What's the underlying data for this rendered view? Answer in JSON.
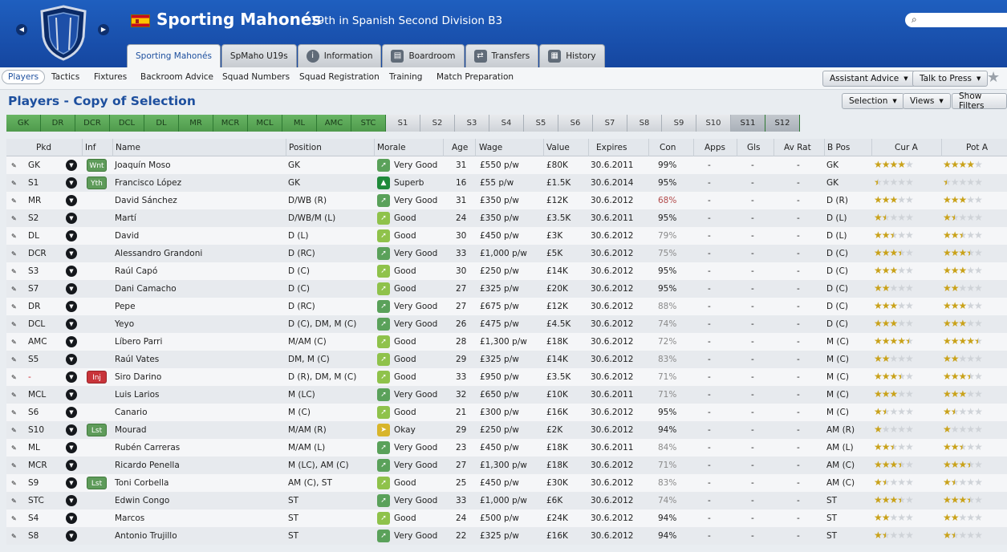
{
  "header": {
    "club_name": "Sporting Mahonés",
    "subtitle": "19th in Spanish Second Division B3",
    "nav_prev": "◀",
    "nav_next": "▶",
    "search_placeholder": ""
  },
  "tabs": [
    {
      "label": "Sporting Mahonés",
      "icon": ""
    },
    {
      "label": "SpMaho U19s",
      "icon": ""
    },
    {
      "label": "Information",
      "icon": "info-icon"
    },
    {
      "label": "Boardroom",
      "icon": "boardroom-icon"
    },
    {
      "label": "Transfers",
      "icon": "transfers-icon"
    },
    {
      "label": "History",
      "icon": "history-icon"
    }
  ],
  "subnav": {
    "items": [
      "Players",
      "Tactics",
      "Fixtures",
      "Backroom Advice",
      "Squad Numbers",
      "Squad Registration",
      "Training",
      "Match Preparation"
    ],
    "assistant_advice": "Assistant Advice",
    "talk_to_press": "Talk to Press",
    "selection": "Selection",
    "views": "Views",
    "show_filters": "Show Filters"
  },
  "page_title": "Players - Copy of Selection",
  "selection_positions": [
    "GK",
    "DR",
    "DCR",
    "DCL",
    "DL",
    "MR",
    "MCR",
    "MCL",
    "ML",
    "AMC",
    "STC",
    "S1",
    "S2",
    "S3",
    "S4",
    "S5",
    "S6",
    "S7",
    "S8",
    "S9",
    "S10",
    "S11",
    "S12"
  ],
  "columns": {
    "pkd": "Pkd",
    "inf": "Inf",
    "name": "Name",
    "position": "Position",
    "morale": "Morale",
    "age": "Age",
    "wage": "Wage",
    "value": "Value",
    "expires": "Expires",
    "con": "Con",
    "apps": "Apps",
    "gls": "Gls",
    "avrat": "Av Rat",
    "bpos": "B Pos",
    "cura": "Cur A",
    "pota": "Pot A"
  },
  "players": [
    {
      "pkd": "GK",
      "inf": "Wnt",
      "name": "Joaquín Moso",
      "position": "GK",
      "morale": "Very Good",
      "age": "31",
      "wage": "£550 p/w",
      "value": "£80K",
      "expires": "30.6.2011",
      "con": "99%",
      "apps": "-",
      "gls": "-",
      "avrat": "-",
      "bpos": "GK",
      "cur": 4,
      "pot": 4
    },
    {
      "pkd": "S1",
      "inf": "Yth",
      "name": "Francisco López",
      "position": "GK",
      "morale": "Superb",
      "age": "16",
      "wage": "£55 p/w",
      "value": "£1.5K",
      "expires": "30.6.2014",
      "con": "95%",
      "apps": "-",
      "gls": "-",
      "avrat": "-",
      "bpos": "GK",
      "cur": 0.5,
      "pot": 0.5
    },
    {
      "pkd": "MR",
      "inf": "",
      "name": "David Sánchez",
      "position": "D/WB (R)",
      "morale": "Very Good",
      "age": "31",
      "wage": "£350 p/w",
      "value": "£12K",
      "expires": "30.6.2012",
      "con": "68%",
      "apps": "-",
      "gls": "-",
      "avrat": "-",
      "bpos": "D (R)",
      "cur": 3,
      "pot": 3
    },
    {
      "pkd": "S2",
      "inf": "",
      "name": "Martí",
      "position": "D/WB/M (L)",
      "morale": "Good",
      "age": "24",
      "wage": "£350 p/w",
      "value": "£3.5K",
      "expires": "30.6.2011",
      "con": "95%",
      "apps": "-",
      "gls": "-",
      "avrat": "-",
      "bpos": "D (L)",
      "cur": 1.5,
      "pot": 1.5
    },
    {
      "pkd": "DL",
      "inf": "",
      "name": "David",
      "position": "D (L)",
      "morale": "Good",
      "age": "30",
      "wage": "£450 p/w",
      "value": "£3K",
      "expires": "30.6.2012",
      "con": "79%",
      "apps": "-",
      "gls": "-",
      "avrat": "-",
      "bpos": "D (L)",
      "cur": 2.5,
      "pot": 2.5
    },
    {
      "pkd": "DCR",
      "inf": "",
      "name": "Alessandro Grandoni",
      "position": "D (RC)",
      "morale": "Very Good",
      "age": "33",
      "wage": "£1,000 p/w",
      "value": "£5K",
      "expires": "30.6.2012",
      "con": "75%",
      "apps": "-",
      "gls": "-",
      "avrat": "-",
      "bpos": "D (C)",
      "cur": 3.5,
      "pot": 3.5
    },
    {
      "pkd": "S3",
      "inf": "",
      "name": "Raúl Capó",
      "position": "D (C)",
      "morale": "Good",
      "age": "30",
      "wage": "£250 p/w",
      "value": "£14K",
      "expires": "30.6.2012",
      "con": "95%",
      "apps": "-",
      "gls": "-",
      "avrat": "-",
      "bpos": "D (C)",
      "cur": 3,
      "pot": 3
    },
    {
      "pkd": "S7",
      "inf": "",
      "name": "Dani Camacho",
      "position": "D (C)",
      "morale": "Good",
      "age": "27",
      "wage": "£325 p/w",
      "value": "£20K",
      "expires": "30.6.2012",
      "con": "95%",
      "apps": "-",
      "gls": "-",
      "avrat": "-",
      "bpos": "D (C)",
      "cur": 2,
      "pot": 2
    },
    {
      "pkd": "DR",
      "inf": "",
      "name": "Pepe",
      "position": "D (RC)",
      "morale": "Very Good",
      "age": "27",
      "wage": "£675 p/w",
      "value": "£12K",
      "expires": "30.6.2012",
      "con": "88%",
      "apps": "-",
      "gls": "-",
      "avrat": "-",
      "bpos": "D (C)",
      "cur": 3,
      "pot": 3
    },
    {
      "pkd": "DCL",
      "inf": "",
      "name": "Yeyo",
      "position": "D (C), DM, M (C)",
      "morale": "Very Good",
      "age": "26",
      "wage": "£475 p/w",
      "value": "£4.5K",
      "expires": "30.6.2012",
      "con": "74%",
      "apps": "-",
      "gls": "-",
      "avrat": "-",
      "bpos": "D (C)",
      "cur": 3,
      "pot": 3
    },
    {
      "pkd": "AMC",
      "inf": "",
      "name": "Líbero Parri",
      "position": "M/AM (C)",
      "morale": "Good",
      "age": "28",
      "wage": "£1,300 p/w",
      "value": "£18K",
      "expires": "30.6.2012",
      "con": "72%",
      "apps": "-",
      "gls": "-",
      "avrat": "-",
      "bpos": "M (C)",
      "cur": 4.5,
      "pot": 4.5
    },
    {
      "pkd": "S5",
      "inf": "",
      "name": "Raúl Vates",
      "position": "DM, M (C)",
      "morale": "Good",
      "age": "29",
      "wage": "£325 p/w",
      "value": "£14K",
      "expires": "30.6.2012",
      "con": "83%",
      "apps": "-",
      "gls": "-",
      "avrat": "-",
      "bpos": "M (C)",
      "cur": 2,
      "pot": 2
    },
    {
      "pkd": "-",
      "inf": "Inj",
      "name": "Siro Darino",
      "position": "D (R), DM, M (C)",
      "morale": "Good",
      "age": "33",
      "wage": "£950 p/w",
      "value": "£3.5K",
      "expires": "30.6.2012",
      "con": "71%",
      "apps": "-",
      "gls": "-",
      "avrat": "-",
      "bpos": "M (C)",
      "cur": 3.5,
      "pot": 3.5
    },
    {
      "pkd": "MCL",
      "inf": "",
      "name": "Luis Larios",
      "position": "M (LC)",
      "morale": "Very Good",
      "age": "32",
      "wage": "£650 p/w",
      "value": "£10K",
      "expires": "30.6.2011",
      "con": "71%",
      "apps": "-",
      "gls": "-",
      "avrat": "-",
      "bpos": "M (C)",
      "cur": 3,
      "pot": 3
    },
    {
      "pkd": "S6",
      "inf": "",
      "name": "Canario",
      "position": "M (C)",
      "morale": "Good",
      "age": "21",
      "wage": "£300 p/w",
      "value": "£16K",
      "expires": "30.6.2012",
      "con": "95%",
      "apps": "-",
      "gls": "-",
      "avrat": "-",
      "bpos": "M (C)",
      "cur": 1.5,
      "pot": 1.5
    },
    {
      "pkd": "S10",
      "inf": "Lst",
      "name": "Mourad",
      "position": "M/AM (R)",
      "morale": "Okay",
      "age": "29",
      "wage": "£250 p/w",
      "value": "£2K",
      "expires": "30.6.2012",
      "con": "94%",
      "apps": "-",
      "gls": "-",
      "avrat": "-",
      "bpos": "AM (R)",
      "cur": 1,
      "pot": 1
    },
    {
      "pkd": "ML",
      "inf": "",
      "name": "Rubén Carreras",
      "position": "M/AM (L)",
      "morale": "Very Good",
      "age": "23",
      "wage": "£450 p/w",
      "value": "£18K",
      "expires": "30.6.2011",
      "con": "84%",
      "apps": "-",
      "gls": "-",
      "avrat": "-",
      "bpos": "AM (L)",
      "cur": 2.5,
      "pot": 2.5
    },
    {
      "pkd": "MCR",
      "inf": "",
      "name": "Ricardo Penella",
      "position": "M (LC), AM (C)",
      "morale": "Very Good",
      "age": "27",
      "wage": "£1,300 p/w",
      "value": "£18K",
      "expires": "30.6.2012",
      "con": "71%",
      "apps": "-",
      "gls": "-",
      "avrat": "-",
      "bpos": "AM (C)",
      "cur": 3.5,
      "pot": 3.5
    },
    {
      "pkd": "S9",
      "inf": "Lst",
      "name": "Toni Corbella",
      "position": "AM (C), ST",
      "morale": "Good",
      "age": "25",
      "wage": "£450 p/w",
      "value": "£30K",
      "expires": "30.6.2012",
      "con": "83%",
      "apps": "-",
      "gls": "-",
      "avrat": "-",
      "bpos": "AM (C)",
      "cur": 1.5,
      "pot": 1.5
    },
    {
      "pkd": "STC",
      "inf": "",
      "name": "Edwin Congo",
      "position": "ST",
      "morale": "Very Good",
      "age": "33",
      "wage": "£1,000 p/w",
      "value": "£6K",
      "expires": "30.6.2012",
      "con": "74%",
      "apps": "-",
      "gls": "-",
      "avrat": "-",
      "bpos": "ST",
      "cur": 3.5,
      "pot": 3.5
    },
    {
      "pkd": "S4",
      "inf": "",
      "name": "Marcos",
      "position": "ST",
      "morale": "Good",
      "age": "24",
      "wage": "£500 p/w",
      "value": "£24K",
      "expires": "30.6.2012",
      "con": "94%",
      "apps": "-",
      "gls": "-",
      "avrat": "-",
      "bpos": "ST",
      "cur": 2,
      "pot": 2
    },
    {
      "pkd": "S8",
      "inf": "",
      "name": "Antonio Trujillo",
      "position": "ST",
      "morale": "Very Good",
      "age": "22",
      "wage": "£325 p/w",
      "value": "£16K",
      "expires": "30.6.2012",
      "con": "94%",
      "apps": "-",
      "gls": "-",
      "avrat": "-",
      "bpos": "ST",
      "cur": 1.5,
      "pot": 1.5
    }
  ],
  "colors": {
    "brand": "#1d4f9e",
    "green_pos": "#5aa15a",
    "red_badge": "#c8343a",
    "star": "#c9a21a"
  }
}
